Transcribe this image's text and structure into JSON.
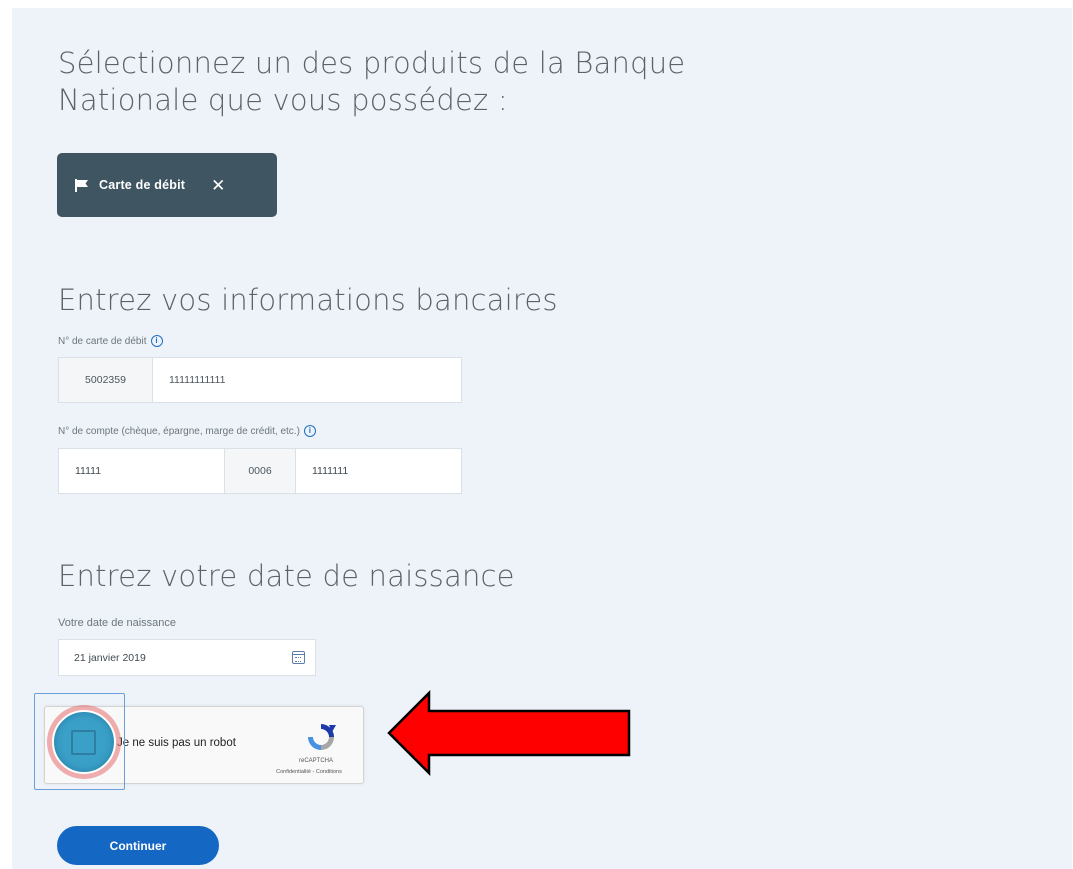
{
  "products": {
    "title": "Sélectionnez un des produits de la Banque Nationale que vous possédez :",
    "chip_label": "Carte de débit",
    "chip_close": "✕"
  },
  "bank_info": {
    "title": "Entrez vos informations bancaires",
    "card_label": "N° de carte de débit",
    "card_prefix": "5002359",
    "card_value": "11111111111",
    "account_label": "N° de compte (chèque, épargne, marge de crédit, etc.)",
    "transit_value": "11111",
    "institution_value": "0006",
    "account_value": "1111111",
    "info_symbol": "i"
  },
  "birthdate": {
    "title": "Entrez votre date de naissance",
    "label": "Votre date de naissance",
    "value": "21 janvier 2019"
  },
  "recaptcha": {
    "label": "Je ne suis pas un robot",
    "brand": "reCAPTCHA",
    "terms": "Confidentialité - Conditions"
  },
  "annotation": {
    "arrow_color": "#ff0000",
    "click_marker_color": "#3aa0c8"
  },
  "actions": {
    "continue_label": "Continuer"
  },
  "colors": {
    "page_bg": "#eef3f9",
    "chip_bg": "#3f5561",
    "primary": "#1467c2"
  }
}
